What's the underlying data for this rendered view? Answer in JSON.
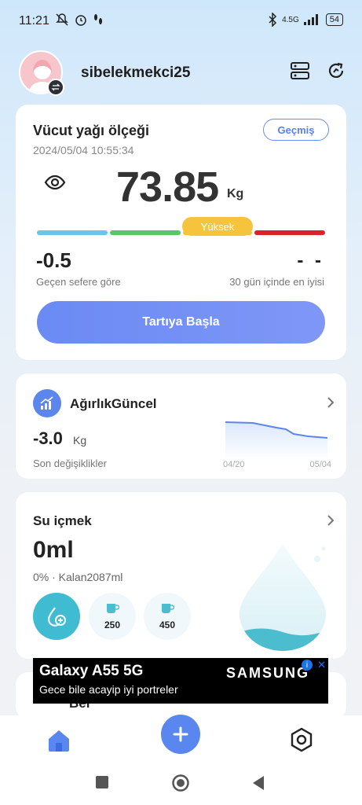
{
  "status_bar": {
    "time": "11:21",
    "network": "4.5G",
    "battery": "54"
  },
  "header": {
    "username": "sibelekmekci25"
  },
  "body_fat_card": {
    "title": "Vücut yağı ölçeği",
    "timestamp": "2024/05/04 10:55:34",
    "history_button": "Geçmiş",
    "weight_value": "73.85",
    "weight_unit": "Kg",
    "level_badge": "Yüksek",
    "level_colors": [
      "#6cc3ec",
      "#5cc46b",
      "#f6c33c",
      "#d9222a"
    ],
    "change_value": "-0.5",
    "change_label": "Geçen sefere göre",
    "best_value": "- -",
    "best_label": "30 gün içinde en iyisi",
    "start_button": "Tartıya Başla"
  },
  "weight_card": {
    "title": "AğırlıkGüncel",
    "value": "-3.0",
    "unit": "Kg",
    "label": "Son değişiklikler",
    "chart_start_label": "04/20",
    "chart_end_label": "05/04"
  },
  "water_card": {
    "title": "Su içmek",
    "amount": "0ml",
    "progress_text": "0% · Kalan2087ml",
    "progress_percent": 0,
    "cup_small": "250",
    "cup_large": "450"
  },
  "ad": {
    "title": "Galaxy A55 5G",
    "subtitle": "Gece bile acayip iyi portreler",
    "brand": "SAMSUNG"
  },
  "partial_card": {
    "label": "Bel"
  }
}
